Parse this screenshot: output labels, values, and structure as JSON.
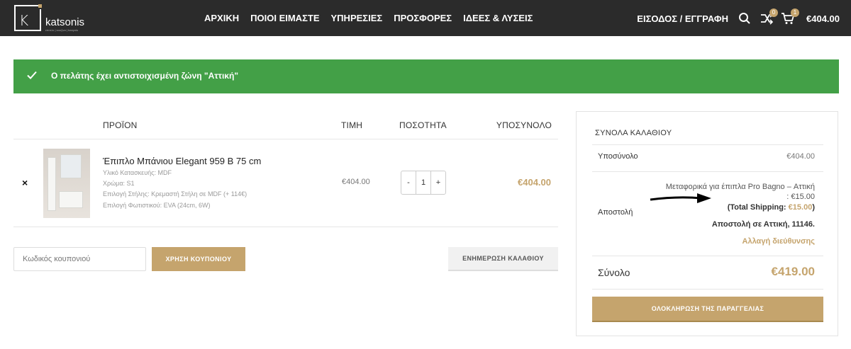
{
  "header": {
    "logo_text": "katsonis",
    "logo_tagline": "επιπλο | κουζινα | banyolu",
    "nav": [
      "ΑΡΧΙΚΗ",
      "ΠΟΙΟΙ ΕΙΜΑΣΤΕ",
      "ΥΠΗΡΕΣΙΕΣ",
      "ΠΡΟΣΦΟΡΕΣ",
      "ΙΔΕΕΣ & ΛΥΣΕΙΣ"
    ],
    "login": "ΕΙΣΟΔΟΣ / ΕΓΓΡΑΦΗ",
    "compare_count": "0",
    "cart_count": "1",
    "cart_total": "€404.00"
  },
  "notice": {
    "text": "Ο πελάτης έχει αντιστοιχισμένη ζώνη \"Αττική\""
  },
  "cart": {
    "headers": {
      "product": "ΠΡΟΪΟΝ",
      "price": "ΤΙΜΗ",
      "quantity": "ΠΟΣΟΤΗΤΑ",
      "subtotal": "ΥΠΟΣΥΝΟΛΟ"
    },
    "item": {
      "remove": "×",
      "name": "Έπιπλο Μπάνιου Elegant 959 B 75 cm",
      "meta": [
        "Υλικό Κατασκευής: MDF",
        "Χρώμα: S1",
        "Επιλογή Στήλης: Κρεμαστή Στήλη σε MDF (+ 114€)",
        "Επιλογή Φωτιστικού: EVA (24cm, 6W)"
      ],
      "price": "€404.00",
      "qty_minus": "-",
      "qty": "1",
      "qty_plus": "+",
      "subtotal": "€404.00"
    },
    "coupon_placeholder": "Κωδικός κουπονιού",
    "apply_coupon": "ΧΡΗΣΗ ΚΟΥΠΟΝΙΟΥ",
    "update_cart": "ΕΝΗΜΕΡΩΣΗ ΚΑΛΑΘΙΟΥ"
  },
  "totals": {
    "title": "ΣΥΝΟΛΑ ΚΑΛΑΘΙΟΥ",
    "subtotal_label": "Υποσύνολο",
    "subtotal_value": "€404.00",
    "shipping_label": "Αποστολή",
    "shipping_method_1": "Μεταφορικά για έπιπλα Pro Bagno – Αττική",
    "shipping_method_2": ": €15.00",
    "total_shipping_open": "(",
    "total_shipping_label": "Total Shipping:",
    "total_shipping_value": "€15.00",
    "total_shipping_close": ")",
    "ship_to": "Αποστολή σε Αττική, 11146.",
    "change_address": "Αλλαγή διεύθυνσης",
    "total_label": "Σύνολο",
    "total_value": "€419.00",
    "checkout": "ΟΛΟΚΛΗΡΩΣΗ ΤΗΣ ΠΑΡΑΓΓΕΛΙΑΣ"
  },
  "colors": {
    "accent": "#c5a46d",
    "header_bg": "#2b2b2b",
    "notice_bg": "#43a047"
  }
}
